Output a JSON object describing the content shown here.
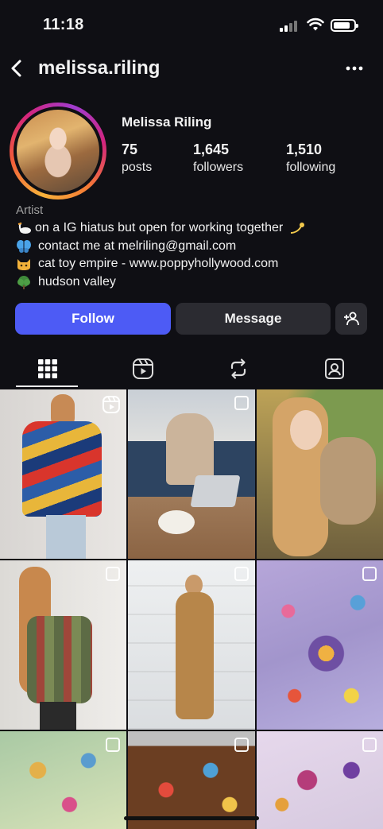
{
  "status_bar": {
    "time": "11:18"
  },
  "header": {
    "username": "melissa.riling"
  },
  "profile": {
    "display_name": "Melissa Riling",
    "stats": [
      {
        "value": "75",
        "label": "posts"
      },
      {
        "value": "1,645",
        "label": "followers"
      },
      {
        "value": "1,510",
        "label": "following"
      }
    ],
    "category": "Artist",
    "bio_lines": [
      {
        "icon": "swan-emoji",
        "text": "on a IG hiatus but open for working together"
      },
      {
        "icon": "butterfly-emoji",
        "text": "contact me at melriling@gmail.com"
      },
      {
        "icon": "cat-emoji",
        "text": "cat toy empire - www.poppyhollywood.com"
      },
      {
        "icon": "tree-emoji",
        "text": "hudson valley"
      }
    ]
  },
  "actions": {
    "follow_label": "Follow",
    "message_label": "Message"
  },
  "tabs": [
    "grid-icon",
    "reels-icon",
    "reposts-icon",
    "tagged-icon"
  ],
  "colors": {
    "background": "#0f0f14",
    "follow_button": "#4d5bf5",
    "secondary_button": "#2b2b31"
  }
}
